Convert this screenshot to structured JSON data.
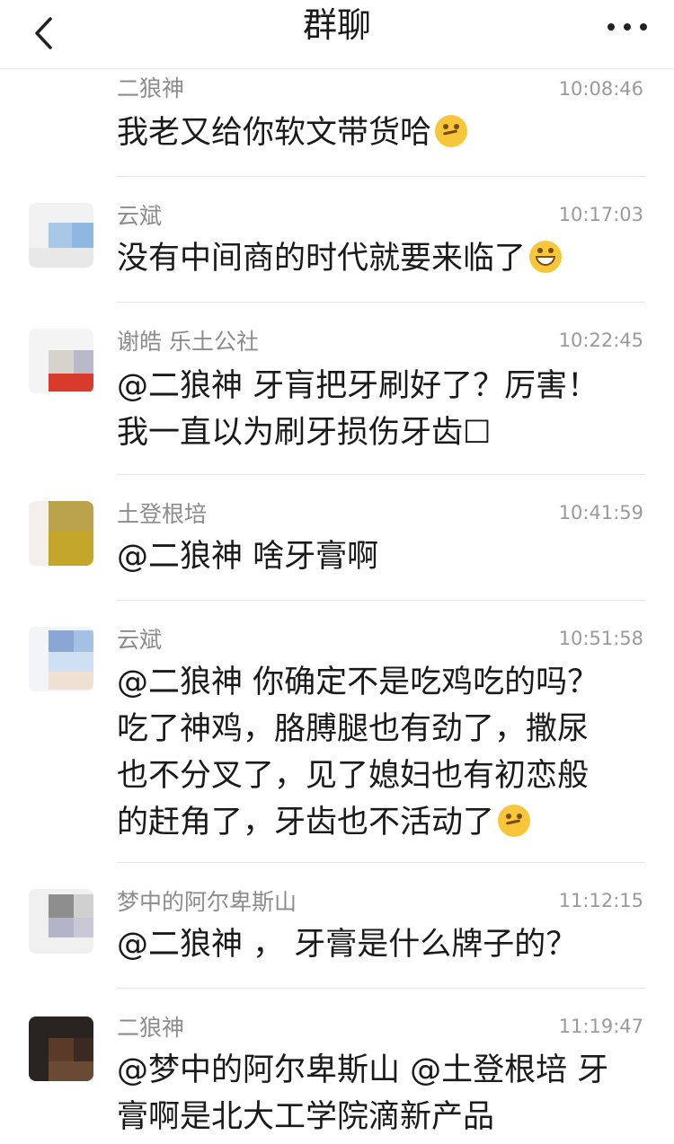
{
  "header": {
    "title": "群聊",
    "back_icon": "chevron-left-icon",
    "more_icon": "more-dots-icon"
  },
  "messages": [
    {
      "sender": "二狼神",
      "time": "10:08:46",
      "lines": [
        "我老又给你软文带货哈"
      ],
      "emoji": "thinking-emoji-icon"
    },
    {
      "sender": "云斌",
      "time": "10:17:03",
      "lines": [
        "没有中间商的时代就要来临了"
      ],
      "emoji": "grin-emoji-icon"
    },
    {
      "sender": "谢皓 乐土公社",
      "time": "10:22:45",
      "lines": [
        "@二狼神 牙肓把牙刷好了？厉害！",
        "我一直以为刷牙损伤牙齿☐"
      ]
    },
    {
      "sender": "土登根培",
      "time": "10:41:59",
      "lines": [
        "@二狼神 啥牙膏啊"
      ]
    },
    {
      "sender": "云斌",
      "time": "10:51:58",
      "lines": [
        "@二狼神 你确定不是吃鸡吃的吗？",
        "吃了神鸡，胳膊腿也有劲了，撒尿",
        "也不分叉了，见了媳妇也有初恋般",
        "的赶角了，牙齿也不活动了"
      ],
      "emoji": "thinking-emoji-icon"
    },
    {
      "sender": "梦中的阿尔卑斯山",
      "time": "11:12:15",
      "lines": [
        "@二狼神 ， 牙膏是什么牌子的？"
      ]
    },
    {
      "sender": "二狼神",
      "time": "11:19:47",
      "lines": [
        "@梦中的阿尔卑斯山 @土登根培 牙",
        "膏啊是北大工学院滴新产品"
      ]
    }
  ],
  "colors": {
    "name": "#8c8c8c",
    "time": "#9a9a9a",
    "text": "#1a1a1a",
    "divider": "#e4e4e4"
  }
}
